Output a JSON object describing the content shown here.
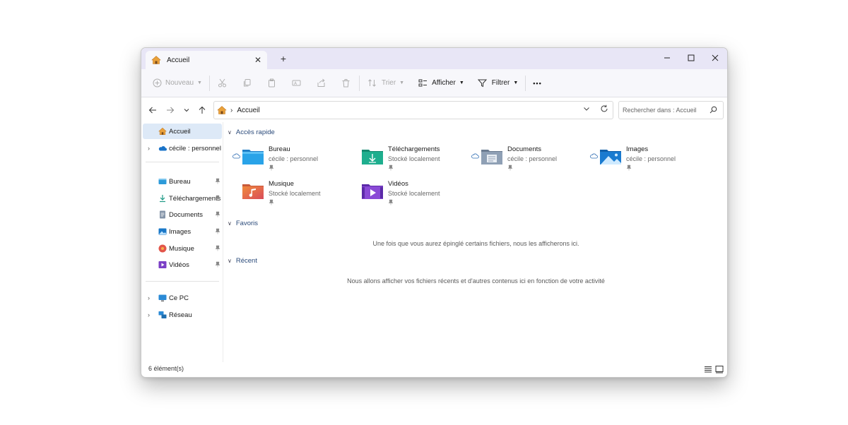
{
  "tab": {
    "title": "Accueil",
    "close": "✕",
    "new_tab": "+"
  },
  "window_controls": {
    "minimize": "—",
    "maximize": "☐",
    "close": "✕"
  },
  "toolbar": {
    "new_label": "Nouveau",
    "sort_label": "Trier",
    "view_label": "Afficher",
    "filter_label": "Filtrer",
    "more": "•••"
  },
  "address": {
    "path": "Accueil",
    "separator": "›"
  },
  "search": {
    "placeholder": "Rechercher dans : Accueil"
  },
  "sidebar": {
    "top": [
      {
        "label": "Accueil",
        "selected": true,
        "icon": "home-icon"
      },
      {
        "label": "cécile : personnel",
        "icon": "onedrive-cloud-icon"
      }
    ],
    "pinned": [
      {
        "label": "Bureau",
        "icon": "desktop-folder-icon"
      },
      {
        "label": "Téléchargements",
        "icon": "download-icon"
      },
      {
        "label": "Documents",
        "icon": "documents-icon"
      },
      {
        "label": "Images",
        "icon": "pictures-icon"
      },
      {
        "label": "Musique",
        "icon": "music-icon"
      },
      {
        "label": "Vidéos",
        "icon": "videos-icon"
      }
    ],
    "bottom": [
      {
        "label": "Ce PC",
        "icon": "pc-icon"
      },
      {
        "label": "Réseau",
        "icon": "network-icon"
      }
    ]
  },
  "sections": {
    "quick_access": "Accès rapide",
    "favorites": "Favoris",
    "recent": "Récent"
  },
  "quick_access": [
    {
      "name": "Bureau",
      "sub": "cécile : personnel",
      "cloud": true,
      "icon": "desktop-folder-icon"
    },
    {
      "name": "Téléchargements",
      "sub": "Stocké localement",
      "cloud": false,
      "icon": "downloads-folder-icon"
    },
    {
      "name": "Documents",
      "sub": "cécile : personnel",
      "cloud": true,
      "icon": "documents-folder-icon"
    },
    {
      "name": "Images",
      "sub": "cécile : personnel",
      "cloud": true,
      "icon": "pictures-folder-icon"
    },
    {
      "name": "Musique",
      "sub": "Stocké localement",
      "cloud": false,
      "icon": "music-folder-icon"
    },
    {
      "name": "Vidéos",
      "sub": "Stocké localement",
      "cloud": false,
      "icon": "videos-folder-icon"
    }
  ],
  "messages": {
    "favorites_empty": "Une fois que vous aurez épinglé certains fichiers, nous les afficherons ici.",
    "recent_empty": "Nous allons afficher vos fichiers récents et d'autres contenus ici en fonction de votre activité"
  },
  "status": {
    "count": "6 élément(s)"
  }
}
